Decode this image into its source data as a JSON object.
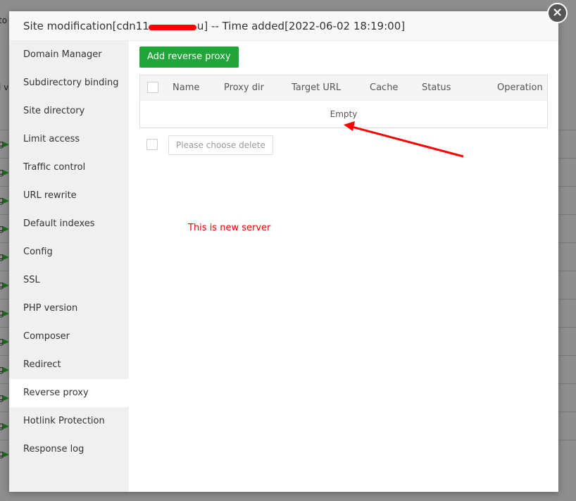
{
  "background": {
    "row_label": "g",
    "top_text": "to",
    "second_text": "l v"
  },
  "dialog": {
    "title_prefix": "Site modification[cdn11",
    "title_suffix": "u] -- Time added[2022-06-02 18:19:00]",
    "close_icon": "×",
    "sidebar": [
      "Domain Manager",
      "Subdirectory binding",
      "Site directory",
      "Limit access",
      "Traffic control",
      "URL rewrite",
      "Default indexes",
      "Config",
      "SSL",
      "PHP version",
      "Composer",
      "Redirect",
      "Reverse proxy",
      "Hotlink Protection",
      "Response log"
    ],
    "active_item": "Reverse proxy",
    "add_button": "Add reverse proxy",
    "columns": [
      "Name",
      "Proxy dir",
      "Target URL",
      "Cache",
      "Status",
      "Operation"
    ],
    "empty_text": "Empty",
    "delete_button": "Please choose delete",
    "annotation": "This is new server"
  },
  "colors": {
    "accent": "#20a53a",
    "annotation": "#ff0000"
  }
}
